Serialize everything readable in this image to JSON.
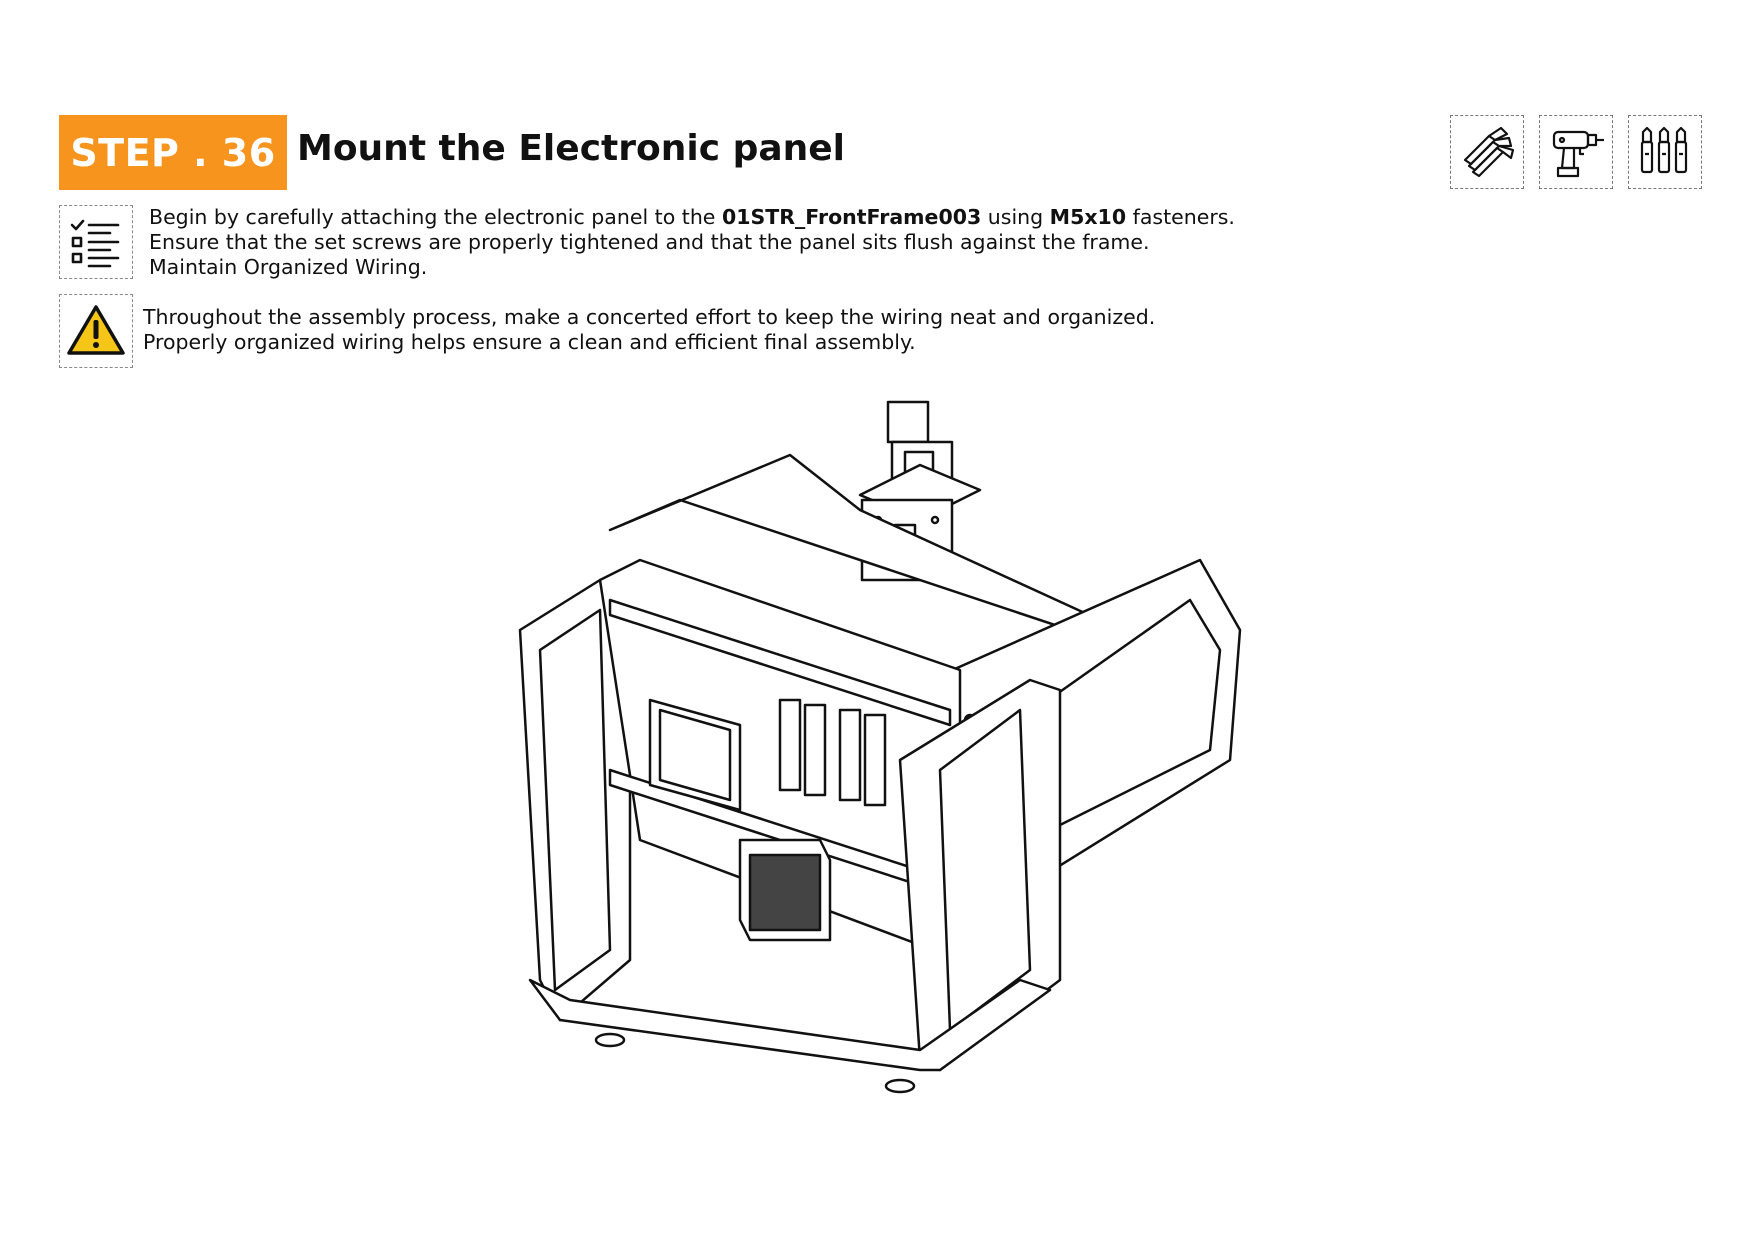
{
  "step": {
    "badge": "STEP . 36",
    "title": "Mount the Electronic panel"
  },
  "tools": [
    {
      "icon": "hex-key-set-icon"
    },
    {
      "icon": "power-drill-icon"
    },
    {
      "icon": "screwdriver-bits-icon"
    }
  ],
  "instructions": {
    "icon": "checklist-icon",
    "line1_pre": "Begin by carefully attaching the electronic panel to the ",
    "line1_part": "01STR_FrontFrame003",
    "line1_mid": " using ",
    "line1_fastener": "M5x10",
    "line1_post": " fasteners.",
    "line2": "Ensure that the set screws are properly tightened and that the panel sits flush against the frame.",
    "line3": "Maintain Organized Wiring."
  },
  "warning": {
    "icon": "warning-icon",
    "color": "#f5c518",
    "line1": "Throughout the assembly process, make a concerted effort to keep the wiring neat and organized.",
    "line2": "Properly organized wiring helps ensure a clean and efficient final assembly."
  },
  "colors": {
    "accent": "#f7941e"
  }
}
